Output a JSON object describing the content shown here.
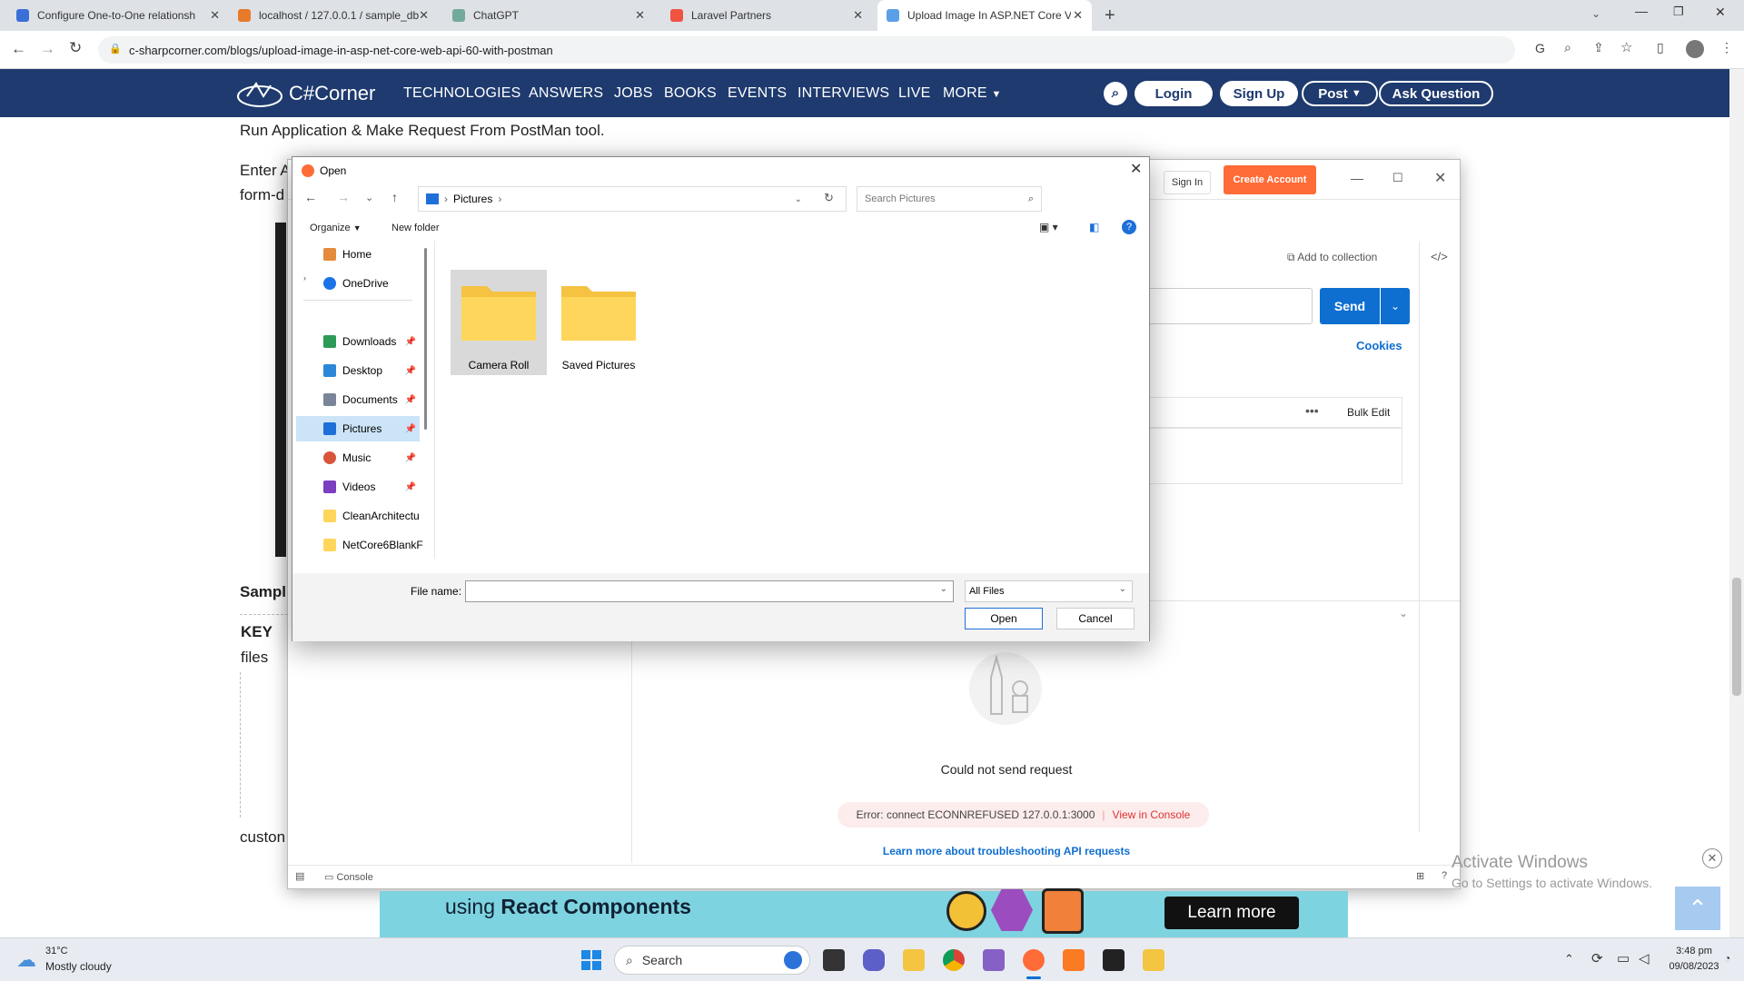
{
  "browser": {
    "tabs": [
      {
        "title": "Configure One-to-One relationsh"
      },
      {
        "title": "localhost / 127.0.0.1 / sample_db"
      },
      {
        "title": "ChatGPT"
      },
      {
        "title": "Laravel Partners"
      },
      {
        "title": "Upload Image In ASP.NET Core V"
      }
    ],
    "url": "c-sharpcorner.com/blogs/upload-image-in-asp-net-core-web-api-60-with-postman"
  },
  "site": {
    "logo": "C#Corner",
    "nav": [
      "TECHNOLOGIES",
      "ANSWERS",
      "JOBS",
      "BOOKS",
      "EVENTS",
      "INTERVIEWS",
      "LIVE",
      "MORE"
    ],
    "login": "Login",
    "signup": "Sign Up",
    "post": "Post",
    "ask": "Ask Question"
  },
  "article": {
    "line1": "Run Application & Make Request From PostMan tool.",
    "line2": "Enter A",
    "line3": "form-d",
    "sample": "Sampl",
    "key": "KEY",
    "files": "files",
    "custom": "custon"
  },
  "postman": {
    "signin": "Sign In",
    "create_account": "Create Account",
    "add_to_collection": "Add to collection",
    "send": "Send",
    "cookies": "Cookies",
    "bulk_edit": "Bulk Edit",
    "could_not_send": "Could not send request",
    "error": "Error: connect ECONNREFUSED 127.0.0.1:3000",
    "view_console": "View in Console",
    "learn_more_link": "Learn more about troubleshooting API requests",
    "console": "Console"
  },
  "dialog": {
    "title": "Open",
    "breadcrumb": "Pictures",
    "search_placeholder": "Search Pictures",
    "organize": "Organize",
    "new_folder": "New folder",
    "nav_items": [
      {
        "label": "Home",
        "pinned": false
      },
      {
        "label": "OneDrive",
        "pinned": false
      },
      {
        "label": "Downloads",
        "pinned": true
      },
      {
        "label": "Desktop",
        "pinned": true
      },
      {
        "label": "Documents",
        "pinned": true
      },
      {
        "label": "Pictures",
        "pinned": true
      },
      {
        "label": "Music",
        "pinned": true
      },
      {
        "label": "Videos",
        "pinned": true
      },
      {
        "label": "CleanArchitectu",
        "pinned": false
      },
      {
        "label": "NetCore6BlankF",
        "pinned": false
      }
    ],
    "folders": [
      "Camera Roll",
      "Saved Pictures"
    ],
    "file_name_label": "File name:",
    "file_name_value": "",
    "filter": "All Files",
    "open": "Open",
    "cancel": "Cancel"
  },
  "ad": {
    "text_prefix": "using",
    "text_bold": "React Components",
    "button": "Learn more"
  },
  "watermark": {
    "line1": "Activate Windows",
    "line2": "Go to Settings to activate Windows."
  },
  "taskbar": {
    "temp": "31°C",
    "weather": "Mostly cloudy",
    "search": "Search",
    "time": "3:48 pm",
    "date": "09/08/2023"
  },
  "colors": {
    "nav_bg": "#1e3a6e",
    "postman_orange": "#ff6c37",
    "send_blue": "#0f6fd1",
    "folder_yellow": "#ffd65c",
    "ad_bg": "#7ed3e0"
  }
}
